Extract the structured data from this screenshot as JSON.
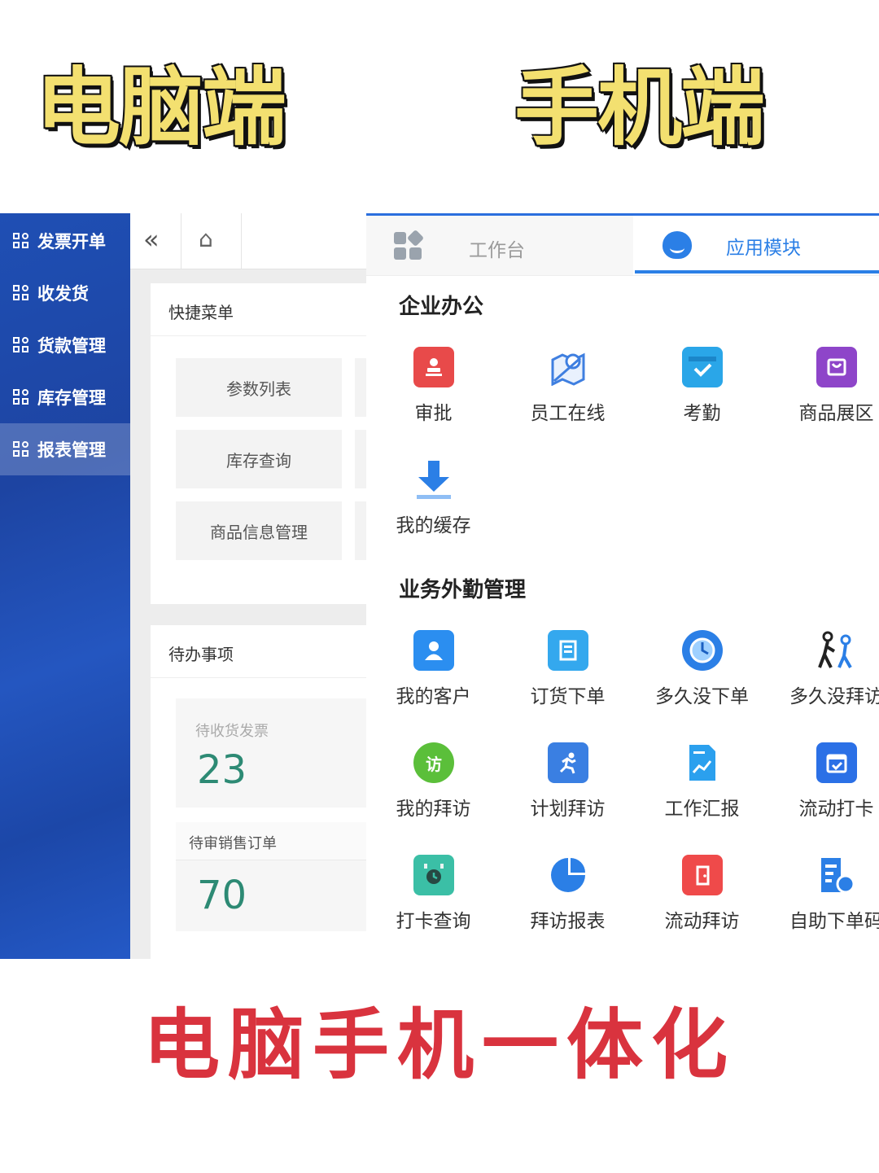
{
  "headings": {
    "desktop": "电脑端",
    "mobile": "手机端",
    "slogan": "电脑手机一体化"
  },
  "desktop": {
    "sidebar": {
      "items": [
        {
          "label": "发票开单",
          "active": false
        },
        {
          "label": "收发货",
          "active": false
        },
        {
          "label": "货款管理",
          "active": false
        },
        {
          "label": "库存管理",
          "active": false
        },
        {
          "label": "报表管理",
          "active": true
        }
      ]
    },
    "topbar": {
      "collapse_icon": "double-chevron-left-icon",
      "home_icon": "home-icon"
    },
    "quick_menu": {
      "title": "快捷菜单",
      "buttons": [
        "参数列表",
        "库存查询",
        "商品信息管理"
      ]
    },
    "todo": {
      "title": "待办事项",
      "items": [
        {
          "label": "待收货发票",
          "value": "23"
        },
        {
          "label": "待审销售订单",
          "value": "70"
        }
      ]
    }
  },
  "mobile": {
    "tabs": [
      {
        "label": "工作台",
        "icon": "grid-icon",
        "active": false
      },
      {
        "label": "应用模块",
        "icon": "apps-icon",
        "active": true
      }
    ],
    "sections": [
      {
        "title": "企业办公",
        "apps": [
          {
            "label": "审批",
            "icon": "stamp-icon",
            "color": "#e84a4a"
          },
          {
            "label": "员工在线",
            "icon": "map-pin-icon",
            "color": "#3f7fe0"
          },
          {
            "label": "考勤",
            "icon": "calendar-check-icon",
            "color": "#2aa6e8"
          },
          {
            "label": "商品展区",
            "icon": "shopping-bag-icon",
            "color": "#8e45c9"
          },
          {
            "label": "我的缓存",
            "icon": "download-icon",
            "color": "#2b7fe6"
          }
        ]
      },
      {
        "title": "业务外勤管理",
        "apps": [
          {
            "label": "我的客户",
            "icon": "customer-icon",
            "color": "#2b8ef0"
          },
          {
            "label": "订货下单",
            "icon": "order-doc-icon",
            "color": "#34a8ee"
          },
          {
            "label": "多久没下单",
            "icon": "clock-icon",
            "color": "#2b7fe6"
          },
          {
            "label": "多久没拜访",
            "icon": "walking-people-icon",
            "color": "#2b7fe6"
          },
          {
            "label": "我的拜访",
            "icon": "visit-badge-icon",
            "color": "#5bbf3a"
          },
          {
            "label": "计划拜访",
            "icon": "runner-icon",
            "color": "#3a7fe2"
          },
          {
            "label": "工作汇报",
            "icon": "report-chart-icon",
            "color": "#2ba0ee"
          },
          {
            "label": "流动打卡",
            "icon": "calendar-checkin-icon",
            "color": "#2b70e6"
          },
          {
            "label": "打卡查询",
            "icon": "alarm-clock-icon",
            "color": "#3bbfa6"
          },
          {
            "label": "拜访报表",
            "icon": "pie-chart-icon",
            "color": "#2b7fe6"
          },
          {
            "label": "流动拜访",
            "icon": "door-icon",
            "color": "#ef4a4a"
          },
          {
            "label": "自助下单码",
            "icon": "qr-order-icon",
            "color": "#2b7fe6"
          }
        ]
      }
    ]
  }
}
